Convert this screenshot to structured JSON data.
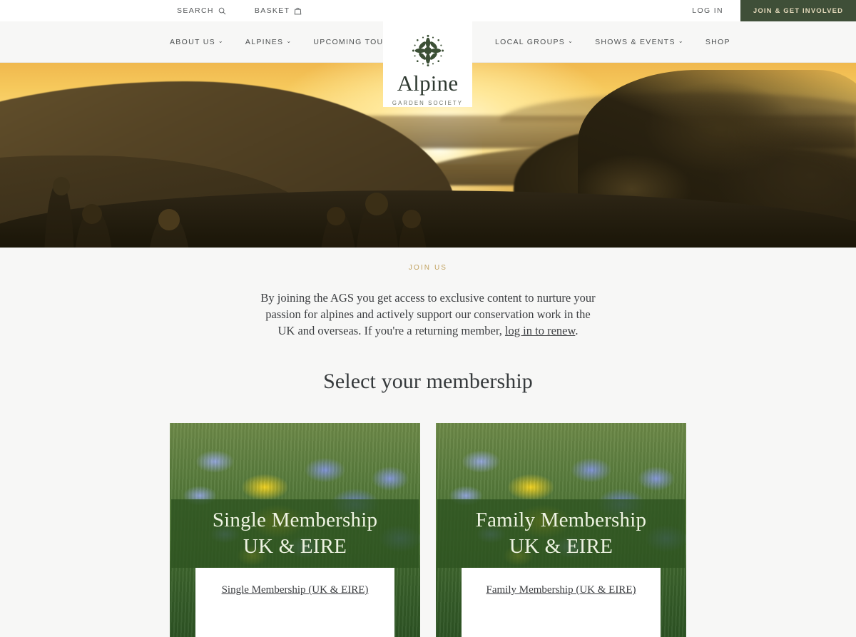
{
  "topbar": {
    "search_label": "SEARCH",
    "search_icon": "search-icon",
    "basket_label": "BASKET",
    "basket_icon": "basket-icon",
    "login_label": "LOG IN",
    "join_label": "JOIN & GET INVOLVED",
    "join_bg": "#3f4f38",
    "join_fg": "#e4d9bb"
  },
  "logo": {
    "wordmark": "Alpine",
    "tagline": "GARDEN SOCIETY",
    "mark_icon": "alpine-rosette-logo-icon",
    "mark_color": "#3c5036"
  },
  "nav": {
    "left": [
      {
        "label": "ABOUT US",
        "caret": "⌄",
        "has_dropdown": true
      },
      {
        "label": "ALPINES",
        "caret": "⌄",
        "has_dropdown": true
      },
      {
        "label": "UPCOMING TOURS",
        "caret": "",
        "has_dropdown": false
      }
    ],
    "right": [
      {
        "label": "LOCAL GROUPS",
        "caret": "⌄",
        "has_dropdown": true
      },
      {
        "label": "SHOWS & EVENTS",
        "caret": "⌄",
        "has_dropdown": true
      },
      {
        "label": "SHOP",
        "caret": "",
        "has_dropdown": false
      }
    ]
  },
  "hero": {
    "alt": "Group of people watching a golden sunset over a lake from a hilltop"
  },
  "join_section": {
    "eyebrow": "JOIN US",
    "eyebrow_color": "#c2a361",
    "intro_before": "By joining the AGS you get access to exclusive content to nurture your passion for alpines and actively support our conservation work in the UK and overseas. If you're a returning member, ",
    "intro_link": "log in to renew",
    "intro_after": ".",
    "title": "Select your membership"
  },
  "memberships": [
    {
      "overlay_line1": "Single Membership",
      "overlay_line2": "UK & EIRE",
      "link_label": "Single Membership (UK & EIRE)",
      "overlay_color": "#2e5420"
    },
    {
      "overlay_line1": "Family Membership",
      "overlay_line2": "UK & EIRE",
      "link_label": "Family Membership (UK & EIRE)",
      "overlay_color": "#2e5420"
    }
  ]
}
